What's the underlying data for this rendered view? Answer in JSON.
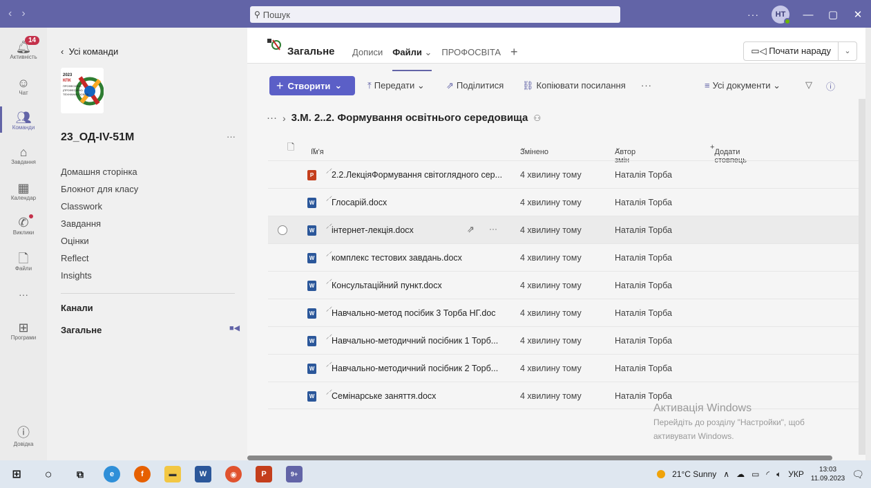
{
  "titlebar": {
    "search_placeholder": "Пошук",
    "more": "···",
    "avatar_initials": "НТ",
    "minimize": "—",
    "maximize": "▢",
    "close": "✕"
  },
  "rail": {
    "activity": {
      "label": "Активність",
      "badge": "14"
    },
    "chat": {
      "label": "Чат"
    },
    "teams": {
      "label": "Команди"
    },
    "assignments": {
      "label": "Завдання"
    },
    "calendar": {
      "label": "Календар"
    },
    "calls": {
      "label": "Виклики"
    },
    "files": {
      "label": "Файли"
    },
    "more": "···",
    "apps": {
      "label": "Програми"
    },
    "help": {
      "label": "Довідка"
    }
  },
  "teampanel": {
    "back_label": "Усі команди",
    "logo_text": "2023 КПК ПРОФЕСІЙНА (ПРОФЕСІЙНО-ТЕХНІЧНА) ОСВІТА",
    "team_name": "23_ОД-IV-51М",
    "team_more": "···",
    "nav": [
      "Домашня сторінка",
      "Блокнот для класу",
      "Classwork",
      "Завдання",
      "Оцінки",
      "Reflect",
      "Insights"
    ],
    "channels_header": "Канали",
    "channel": "Загальне"
  },
  "channel_header": {
    "title": "Загальне",
    "tabs": [
      "Дописи",
      "Файли",
      "ПРОФОСВІТА"
    ],
    "add_tab": "+",
    "meet_button": "Почати нараду"
  },
  "toolbar": {
    "create": "Створити",
    "upload": "Передати",
    "share": "Поділитися",
    "copy_link": "Копіювати посилання",
    "more": "···",
    "view": "Усі документи"
  },
  "breadcrumb": {
    "ellipsis": "···",
    "folder": "3.М. 2..2. Формування освітнього середовища"
  },
  "table": {
    "headers": {
      "name": "Ім'я",
      "modified": "Змінено",
      "author": "Автор змін",
      "add_column": "Додати стовпець"
    },
    "rows": [
      {
        "type": "ppt",
        "name": "2.2.ЛекціяФормування світоглядного сер...",
        "modified": "4 хвилину тому",
        "author": "Наталія Торба"
      },
      {
        "type": "word",
        "name": "Глосарій.docx",
        "modified": "4 хвилину тому",
        "author": "Наталія Торба"
      },
      {
        "type": "word",
        "name": "інтернет-лекція.docx",
        "modified": "4 хвилину тому",
        "author": "Наталія Торба"
      },
      {
        "type": "word",
        "name": "комплекс тестових завдань.docx",
        "modified": "4 хвилину тому",
        "author": "Наталія Торба"
      },
      {
        "type": "word",
        "name": "Консультаційний пункт.docx",
        "modified": "4 хвилину тому",
        "author": "Наталія Торба"
      },
      {
        "type": "word",
        "name": "Навчально-метод посібик 3 Торба НГ.doc",
        "modified": "4 хвилину тому",
        "author": "Наталія Торба"
      },
      {
        "type": "word",
        "name": "Навчально-методичний посібник 1  Торб...",
        "modified": "4 хвилину тому",
        "author": "Наталія Торба"
      },
      {
        "type": "word",
        "name": "Навчально-методичний посібник 2 Торб...",
        "modified": "4 хвилину тому",
        "author": "Наталія Торба"
      },
      {
        "type": "word",
        "name": "Семінарське заняття.docx",
        "modified": "4 хвилину тому",
        "author": "Наталія Торба"
      }
    ]
  },
  "activation": {
    "title": "Активація Windows",
    "line1": "Перейдіть до розділу \"Настройки\", щоб",
    "line2": "активувати Windows."
  },
  "taskbar": {
    "weather": "21°C  Sunny",
    "lang": "УКР",
    "time": "13:03",
    "date": "11.09.2023",
    "teams_badge": "9+"
  },
  "colors": {
    "accent": "#6264a7",
    "create_button": "#5b5fc7",
    "word": "#2b579a",
    "ppt": "#c43e1c"
  }
}
